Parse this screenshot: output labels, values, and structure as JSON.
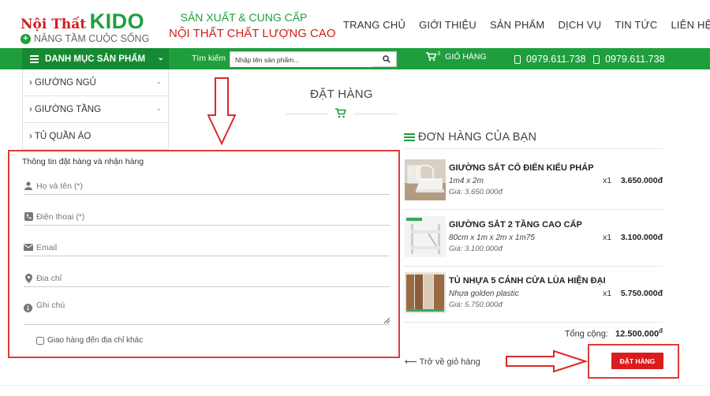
{
  "brand": {
    "name_prefix": "Nội Thất",
    "name_main": "KIDO",
    "tagline": "NÂNG TẦM CUỘC SỐNG"
  },
  "slogan": {
    "line1": "SẢN XUẤT & CUNG CẤP",
    "line2": "NỘI THẤT CHẤT LƯỢNG CAO"
  },
  "topnav": [
    "TRANG CHỦ",
    "GIỚI THIỆU",
    "SẢN PHẨM",
    "DỊCH VỤ",
    "TIN TỨC",
    "LIÊN HỆ"
  ],
  "greenbar": {
    "category_label": "DANH MỤC SẢN PHẨM",
    "search_label": "Tìm kiếm",
    "search_placeholder": "Nhập tên sản phẩm...",
    "cart_label": "GIỎ HÀNG",
    "cart_count": "3",
    "phone1": "0979.611.738",
    "phone2": "0979.611.738"
  },
  "sidebar": {
    "items": [
      "› GIƯỜNG NGỦ",
      "› GIƯỜNG TẦNG",
      "› TỦ QUẦN ÁO"
    ]
  },
  "page_title": "ĐẶT HÀNG",
  "form": {
    "heading": "Thông tin đặt hàng và nhận hàng",
    "name_placeholder": "Họ và tên (*)",
    "phone_placeholder": "Điện thoại (*)",
    "email_placeholder": "Email",
    "address_placeholder": "Địa chỉ",
    "note_placeholder": "Ghi chú",
    "ship_other_label": "Giao hàng đến địa chỉ khác"
  },
  "order": {
    "title": "ĐƠN HÀNG CỦA BẠN",
    "products": [
      {
        "name": "GIƯỜNG SẮT CỔ ĐIỂN KIỂU PHÁP",
        "dims": "1m4 x 2m",
        "price": "Giá: 3.650.000đ",
        "qty": "x1",
        "total": "3.650.000đ"
      },
      {
        "name": "GIƯỜNG SẮT 2 TẦNG CAO CẤP",
        "dims": "80cm x 1m x 2m x 1m75",
        "price": "Giá: 3.100.000đ",
        "qty": "x1",
        "total": "3.100.000đ"
      },
      {
        "name": "TỦ NHỰA 5 CÁNH CỬA LÙA HIỆN ĐẠI",
        "dims": "Nhựa golden plastic",
        "price": "Giá: 5.750.000đ",
        "qty": "x1",
        "total": "5.750.000đ"
      }
    ],
    "total_label": "Tổng cộng:",
    "total_value": "12.500.000",
    "total_currency": "đ",
    "back_label": "Trở về giỏ hàng",
    "submit_label": "ĐẶT HÀNG"
  },
  "colors": {
    "brand_green": "#1f9e3e",
    "brand_red": "#d21d1d",
    "highlight_red": "#e03a3a"
  }
}
